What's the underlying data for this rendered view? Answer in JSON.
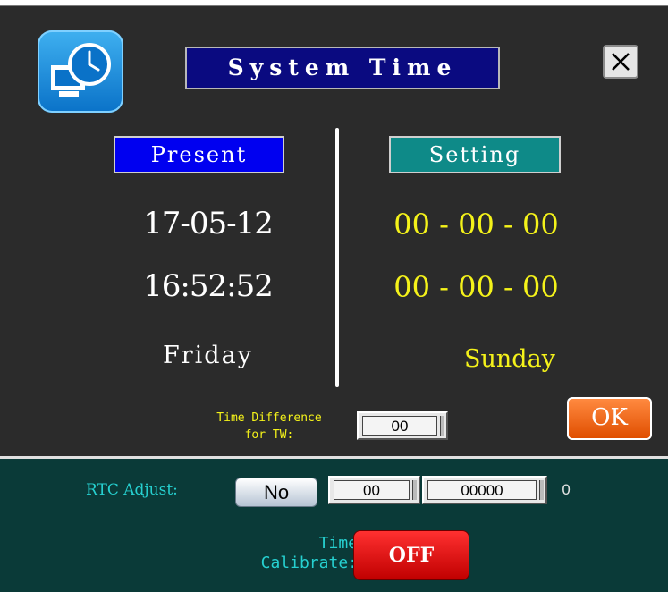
{
  "window": {
    "title": "System Time",
    "close_icon": "close-icon",
    "app_icon": "clock-computer-icon"
  },
  "present": {
    "label": "Present",
    "date": "17-05-12",
    "time": "16:52:52",
    "day": "Friday"
  },
  "setting": {
    "label": "Setting",
    "date": "00 - 00 - 00",
    "time": "00 - 00 - 00",
    "day": "Sunday"
  },
  "time_difference": {
    "label_line1": "Time Difference",
    "label_line2": "for TW:",
    "value": "00"
  },
  "ok_button": {
    "label": "OK"
  },
  "rtc": {
    "label": "RTC Adjust:",
    "toggle": "No",
    "value1": "00",
    "value2": "00000",
    "unit": "0"
  },
  "time_calibrate": {
    "label_line1": "Time",
    "label_line2": "Calibrate:",
    "state": "OFF"
  },
  "colors": {
    "background": "#2b2b2b",
    "title_bg": "#0a0a80",
    "present_tag": "#0000f0",
    "setting_tag": "#0e8a88",
    "setting_text": "#f4f21a",
    "bottom_panel": "#0a3a38",
    "cyan_text": "#26d0d0",
    "ok_button": "#f06010",
    "off_button": "#e00000"
  }
}
